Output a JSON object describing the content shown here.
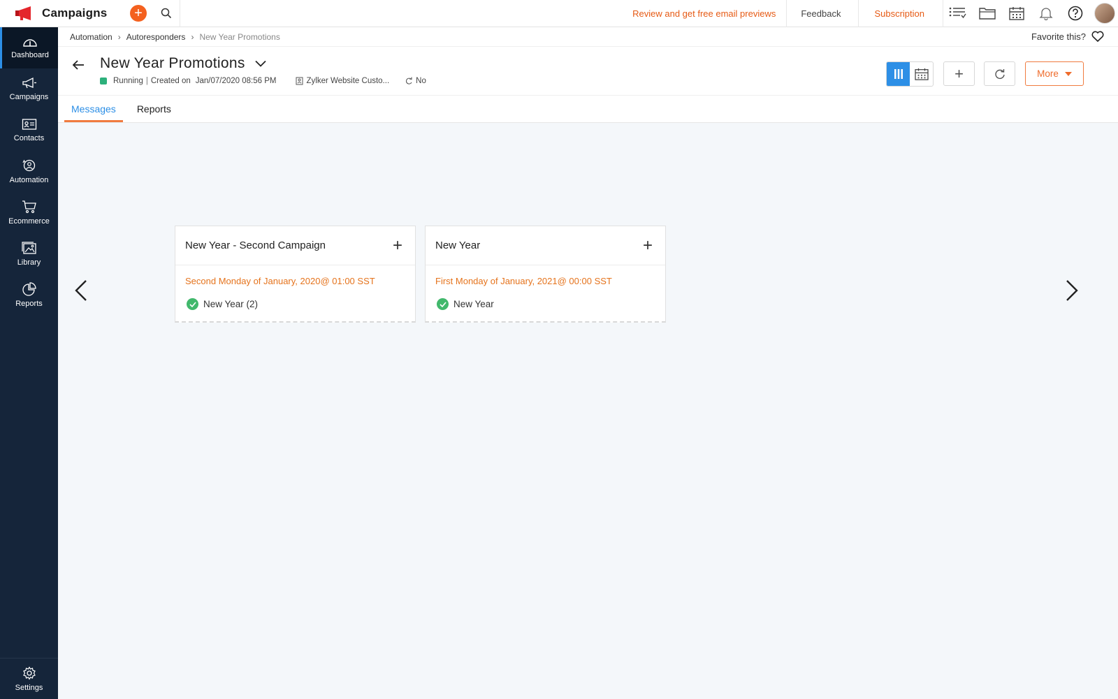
{
  "app": {
    "name": "Campaigns"
  },
  "topbar": {
    "promo_link": "Review and get free email previews",
    "feedback": "Feedback",
    "subscription": "Subscription",
    "icons": [
      "add-icon",
      "search-icon",
      "list-icon",
      "folder-icon",
      "calendar-icon",
      "bell-icon",
      "help-icon",
      "avatar"
    ]
  },
  "sidebar": {
    "items": [
      {
        "label": "Dashboard",
        "icon": "dashboard-icon",
        "active": true
      },
      {
        "label": "Campaigns",
        "icon": "megaphone-icon"
      },
      {
        "label": "Contacts",
        "icon": "contacts-icon"
      },
      {
        "label": "Automation",
        "icon": "automation-icon"
      },
      {
        "label": "Ecommerce",
        "icon": "cart-icon"
      },
      {
        "label": "Library",
        "icon": "library-icon"
      },
      {
        "label": "Reports",
        "icon": "reports-icon"
      }
    ],
    "settings": {
      "label": "Settings",
      "icon": "gear-icon"
    }
  },
  "breadcrumb": [
    "Automation",
    "Autoresponders",
    "New Year Promotions"
  ],
  "favorite": {
    "label": "Favorite this?"
  },
  "header": {
    "title": "New Year Promotions",
    "status": "Running",
    "created_label": "Created on",
    "created_date": "Jan/07/2020 08:56 PM",
    "list_name": "Zylker Website Custo...",
    "repeat": "No",
    "more": "More"
  },
  "tabs": [
    {
      "label": "Messages",
      "active": true
    },
    {
      "label": "Reports",
      "active": false
    }
  ],
  "cards": [
    {
      "title": "New Year - Second Campaign",
      "schedule": "Second Monday of January, 2020@ 01:00 SST",
      "message": "New Year (2)"
    },
    {
      "title": "New Year",
      "schedule": "First Monday of January, 2021@ 00:00 SST",
      "message": "New Year"
    }
  ],
  "colors": {
    "accent": "#2d8fe6",
    "orange": "#ef6c2c",
    "sidebar": "#15253a",
    "success": "#41b86c"
  }
}
